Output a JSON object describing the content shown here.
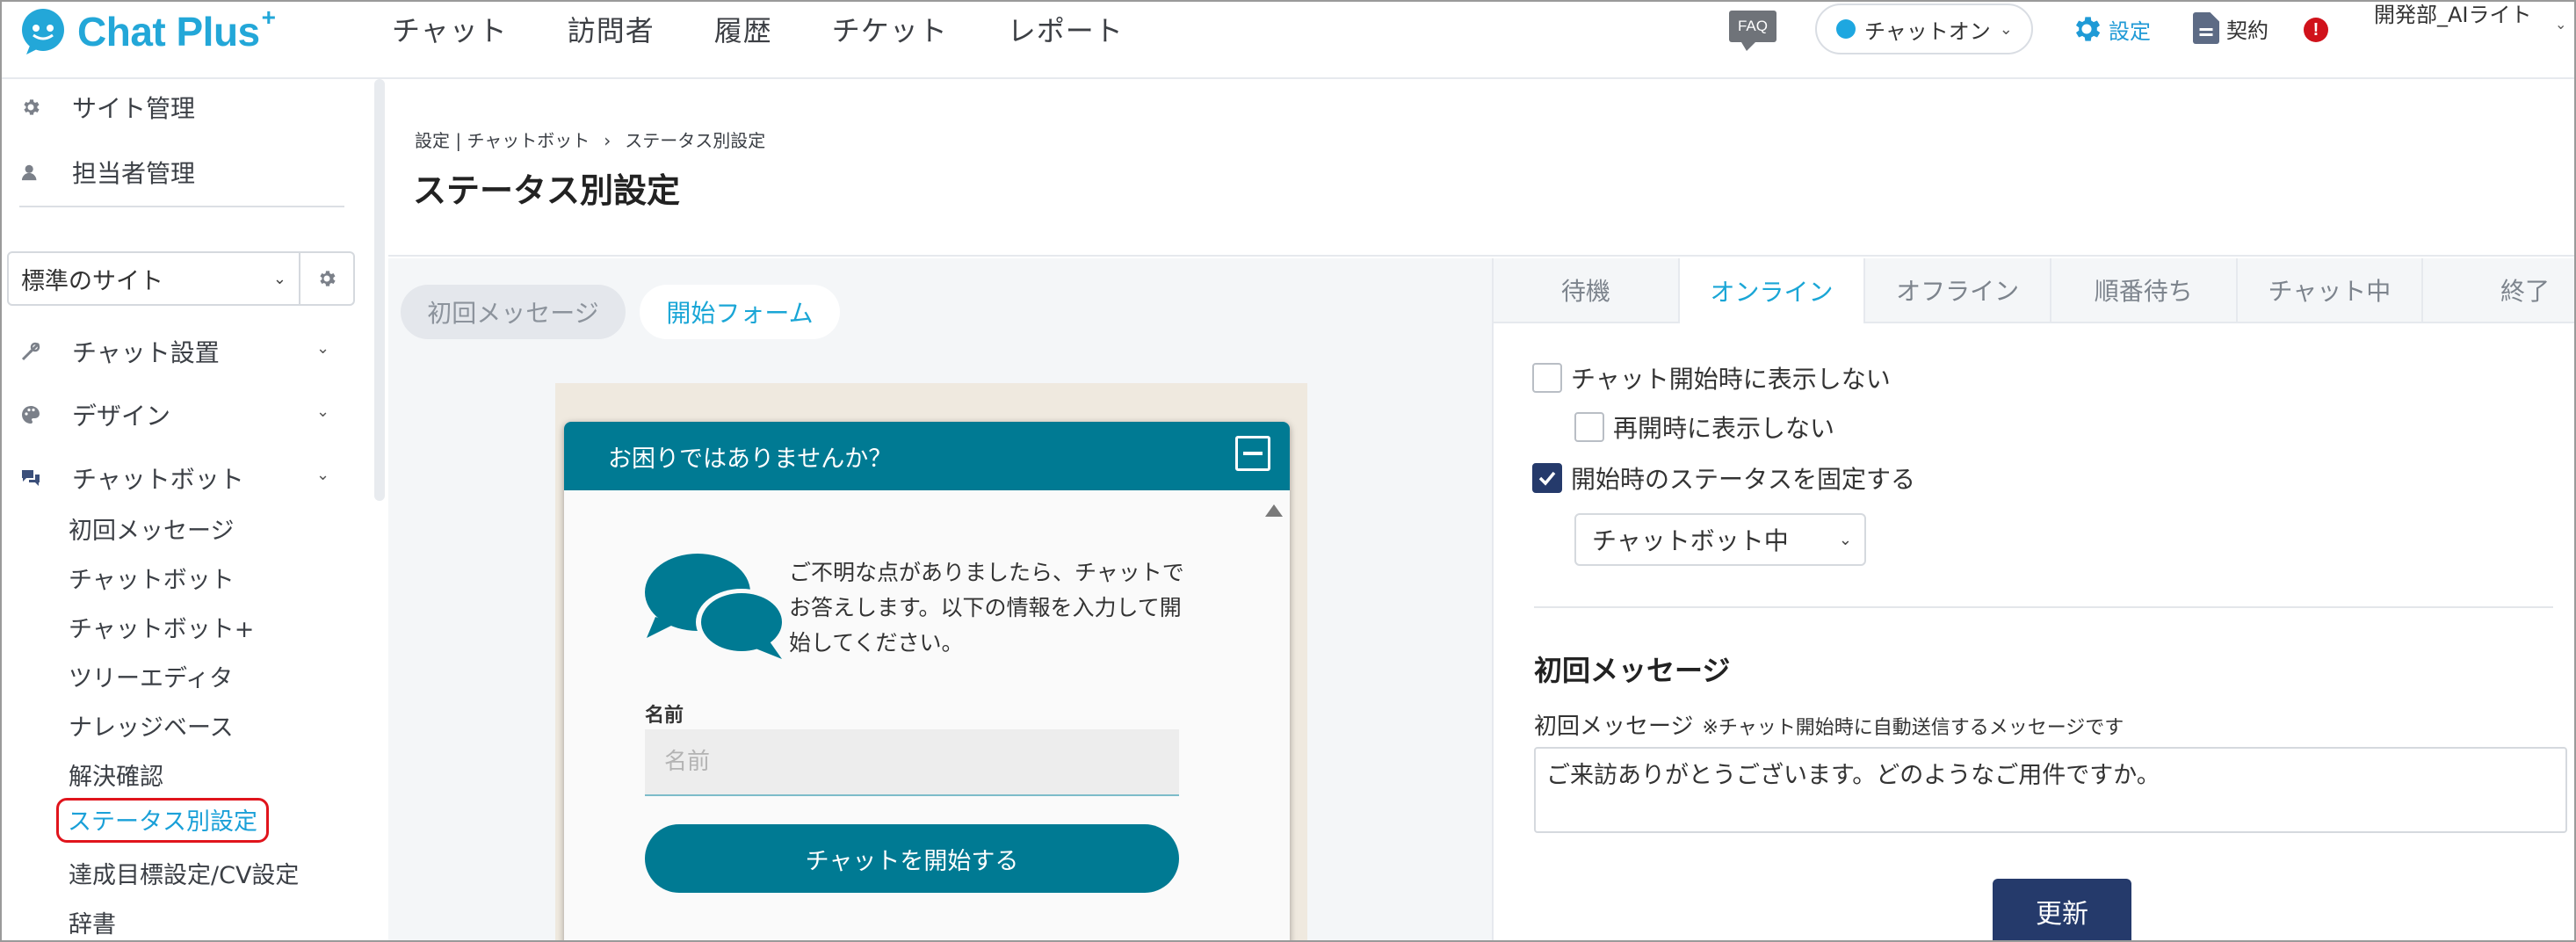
{
  "header": {
    "logo_text": "Chat Plus",
    "logo_plus": "+",
    "nav": [
      "チャット",
      "訪問者",
      "履歴",
      "チケット",
      "レポート"
    ],
    "faq": "FAQ",
    "chat_status": "チャットオン",
    "settings": "設定",
    "contract": "契約",
    "alert": "!",
    "account": "開発部_AIライト"
  },
  "sidebar": {
    "site_admin": "サイト管理",
    "staff_admin": "担当者管理",
    "site_select": "標準のサイト",
    "chat_setup": "チャット設置",
    "design": "デザイン",
    "chatbot": "チャットボット",
    "sub_items": [
      "初回メッセージ",
      "チャットボット",
      "チャットボット+",
      "ツリーエディタ",
      "ナレッジベース",
      "解決確認",
      "ステータス別設定",
      "達成目標設定/CV設定",
      "辞書"
    ],
    "active_index": 6
  },
  "main": {
    "breadcrumb": [
      "設定 | チャットボット",
      "›",
      "ステータス別設定"
    ],
    "title": "ステータス別設定"
  },
  "preview": {
    "tabs": [
      "初回メッセージ",
      "開始フォーム"
    ],
    "widget_title": "お困りではありませんか？",
    "welcome_text": "ご不明な点がありましたら、チャットでお答えします。以下の情報を入力して開始してください。",
    "name_label": "名前",
    "name_placeholder": "名前",
    "start_button": "チャットを開始する"
  },
  "settings": {
    "status_tabs": [
      "待機",
      "オンライン",
      "オフライン",
      "順番待ち",
      "チャット中",
      "終了"
    ],
    "active_tab_index": 1,
    "opt_hide_on_start": "チャット開始時に表示しない",
    "opt_hide_on_restart": "再開時に表示しない",
    "opt_fix_status": "開始時のステータスを固定する",
    "status_select_value": "チャットボット中",
    "section_title": "初回メッセージ",
    "field_label": "初回メッセージ",
    "field_note": "※チャット開始時に自動送信するメッセージです",
    "message_value": "ご来訪ありがとうございます。どのようなご用件ですか。",
    "update_button": "更新"
  },
  "colors": {
    "brand": "#23a7d8",
    "widget_teal": "#007a93",
    "navy": "#253a6b",
    "highlight_red": "#e0141c"
  }
}
